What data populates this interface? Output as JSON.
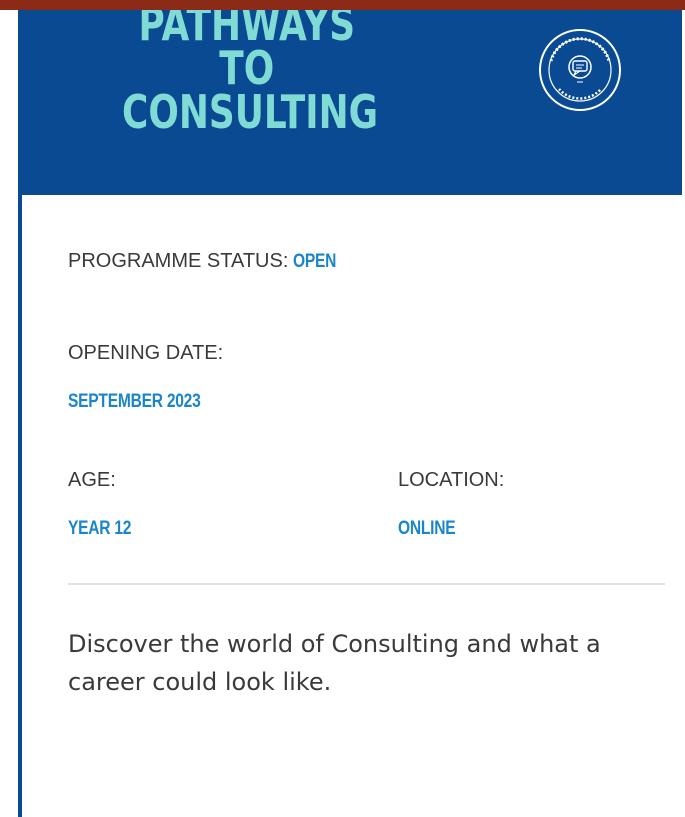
{
  "banner": {
    "title_line1": "PATHWAYS TO",
    "title_line2": "CONSULTING",
    "badge_icon": "pathways-to-consulting-seal-icon",
    "background_color": "#0a4a93",
    "title_color": "#7fdbd4"
  },
  "programme": {
    "status_label": "PROGRAMME STATUS:",
    "status_value": "OPEN",
    "opening_date_label": "OPENING DATE:",
    "opening_date_value": "SEPTEMBER 2023",
    "age_label": "AGE:",
    "age_value": "YEAR 12",
    "location_label": "LOCATION:",
    "location_value": "ONLINE",
    "value_color": "#1a86c9"
  },
  "description": {
    "text": "Discover the world of Consulting and what a career could look like."
  }
}
